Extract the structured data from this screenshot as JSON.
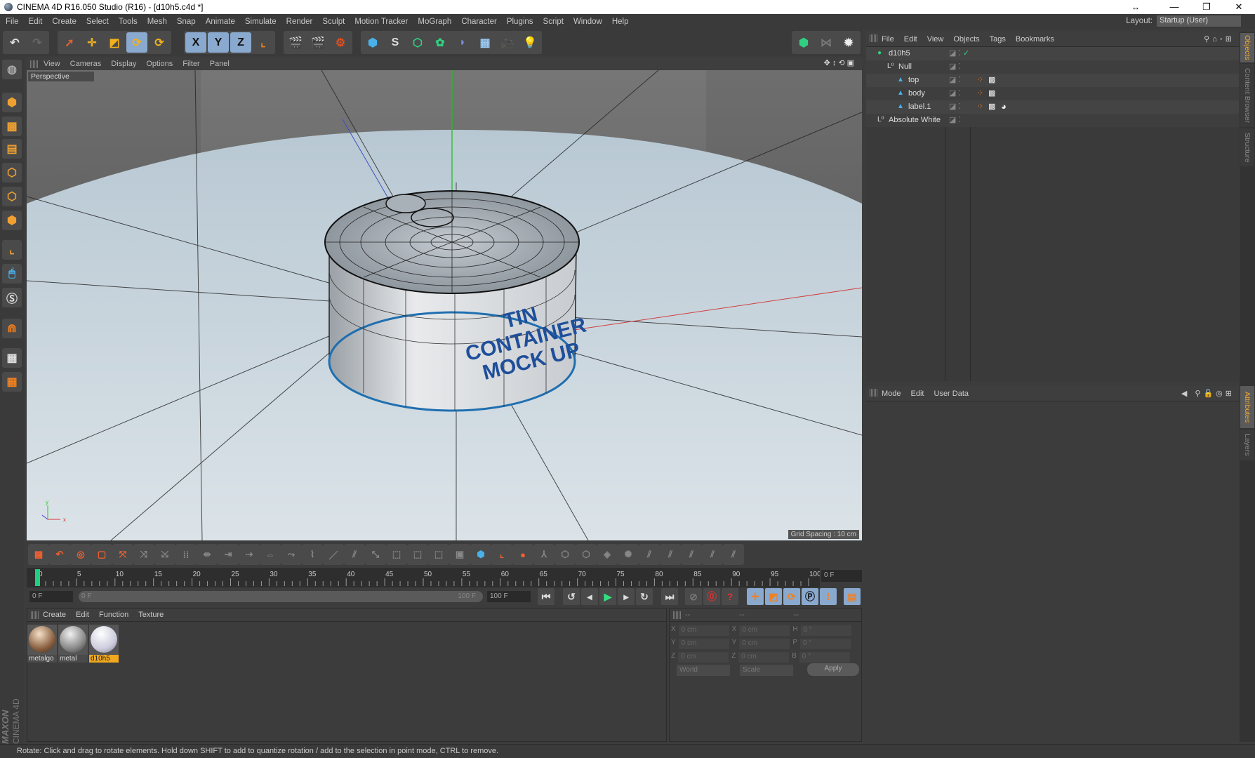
{
  "window": {
    "title": "CINEMA 4D R16.050 Studio (R16) - [d10h5.c4d *]",
    "buttons": [
      "—",
      "❐",
      "✕"
    ],
    "resize_glyph": "↔"
  },
  "menu": [
    "File",
    "Edit",
    "Create",
    "Select",
    "Tools",
    "Mesh",
    "Snap",
    "Animate",
    "Simulate",
    "Render",
    "Sculpt",
    "Motion Tracker",
    "MoGraph",
    "Character",
    "Plugins",
    "Script",
    "Window",
    "Help"
  ],
  "layout": {
    "label": "Layout:",
    "value": "Startup (User)"
  },
  "toolbar": {
    "axis_x": "X",
    "axis_y": "Y",
    "axis_z": "Z"
  },
  "viewport": {
    "menu": [
      "View",
      "Cameras",
      "Display",
      "Options",
      "Filter",
      "Panel"
    ],
    "camera": "Perspective",
    "grid_spacing": "Grid Spacing : 10 cm",
    "label_text": [
      "TIN",
      "CONTAINER",
      "MOCK UP"
    ],
    "colors": {
      "floor": "#c5d3dc",
      "bg": "#5d5d5d",
      "label": "#1f4f9a"
    }
  },
  "timeline": {
    "start": 0,
    "end": 100,
    "step": 5,
    "current": 0,
    "frame_field": "0 F"
  },
  "transport": {
    "start_field": "0 F",
    "range_start": "0 F",
    "range_end": "100 F",
    "end_field": "100 F"
  },
  "materials": {
    "menu": [
      "Create",
      "Edit",
      "Function",
      "Texture"
    ],
    "items": [
      {
        "name": "metalgo",
        "selected": false
      },
      {
        "name": "metal",
        "selected": false
      },
      {
        "name": "d10h5",
        "selected": true
      }
    ]
  },
  "coordinates": {
    "headers": [
      "--",
      "--",
      "--"
    ],
    "rows": [
      {
        "a": "X",
        "av": "0 cm",
        "b": "X",
        "bv": "0 cm",
        "c": "H",
        "cv": "0 °"
      },
      {
        "a": "Y",
        "av": "0 cm",
        "b": "Y",
        "bv": "0 cm",
        "c": "P",
        "cv": "0 °"
      },
      {
        "a": "Z",
        "av": "0 cm",
        "b": "Z",
        "bv": "0 cm",
        "c": "B",
        "cv": "0 °"
      }
    ],
    "mode": "World",
    "type": "Scale",
    "apply": "Apply"
  },
  "objects": {
    "menu": [
      "File",
      "Edit",
      "View",
      "Objects",
      "Tags",
      "Bookmarks"
    ],
    "items": [
      {
        "name": "d10h5",
        "depth": 0,
        "icon": "object-icon"
      },
      {
        "name": "Null",
        "depth": 1,
        "icon": "null-icon"
      },
      {
        "name": "top",
        "depth": 2,
        "icon": "polygon-icon"
      },
      {
        "name": "body",
        "depth": 2,
        "icon": "polygon-icon"
      },
      {
        "name": "label.1",
        "depth": 2,
        "icon": "polygon-icon"
      },
      {
        "name": "Absolute White",
        "depth": 0,
        "icon": "null-icon"
      }
    ]
  },
  "attributes": {
    "menu": [
      "Mode",
      "Edit",
      "User Data"
    ]
  },
  "side_tabs": {
    "top": [
      "Objects",
      "Content Browser",
      "Structure"
    ],
    "bottom": [
      "Attributes",
      "Layers"
    ]
  },
  "status": "Rotate: Click and drag to rotate elements. Hold down SHIFT to add to quantize rotation / add to the selection in point mode, CTRL to remove.",
  "brand": {
    "line1": "MAXON",
    "line2": "CINEMA 4D"
  }
}
